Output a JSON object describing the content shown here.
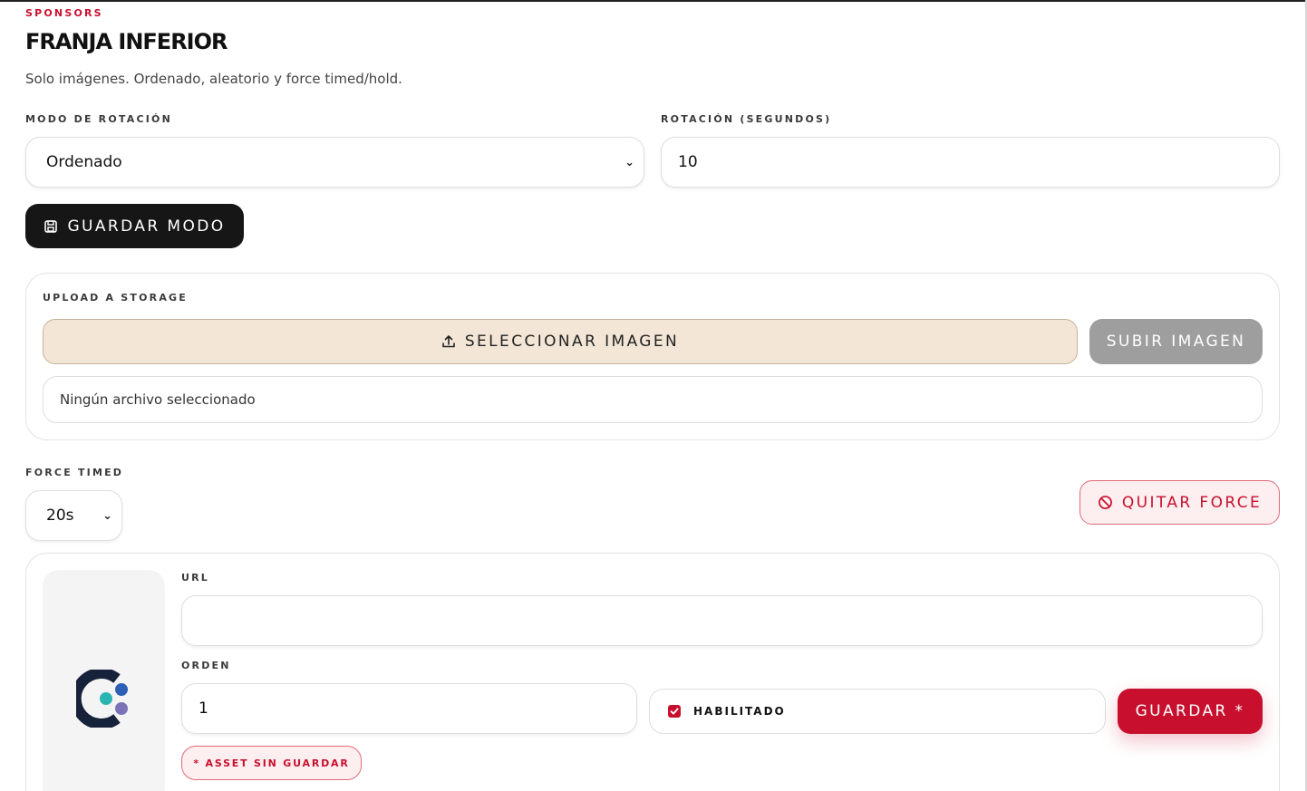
{
  "section": {
    "eyebrow": "SPONSORS",
    "title": "FRANJA INFERIOR",
    "subtitle": "Solo imágenes. Ordenado, aleatorio y force timed/hold."
  },
  "rotation": {
    "mode_label": "MODO DE ROTACIÓN",
    "mode_value": "Ordenado",
    "seconds_label": "ROTACIÓN (SEGUNDOS)",
    "seconds_value": "10",
    "save_button": "GUARDAR MODO"
  },
  "upload": {
    "label": "UPLOAD A STORAGE",
    "select_button": "SELECCIONAR IMAGEN",
    "upload_button": "SUBIR IMAGEN",
    "file_status": "Ningún archivo seleccionado"
  },
  "force": {
    "label": "FORCE TIMED",
    "value": "20s",
    "remove_button": "QUITAR FORCE"
  },
  "asset": {
    "url_label": "URL",
    "url_value": "",
    "order_label": "ORDEN",
    "order_value": "1",
    "enabled_label": "HABILITADO",
    "enabled": true,
    "save_button": "GUARDAR *",
    "unsaved_badge": "* ASSET SIN GUARDAR"
  },
  "colors": {
    "accent_red": "#c8102e",
    "dark": "#161616",
    "beige": "#f3e6d6"
  }
}
